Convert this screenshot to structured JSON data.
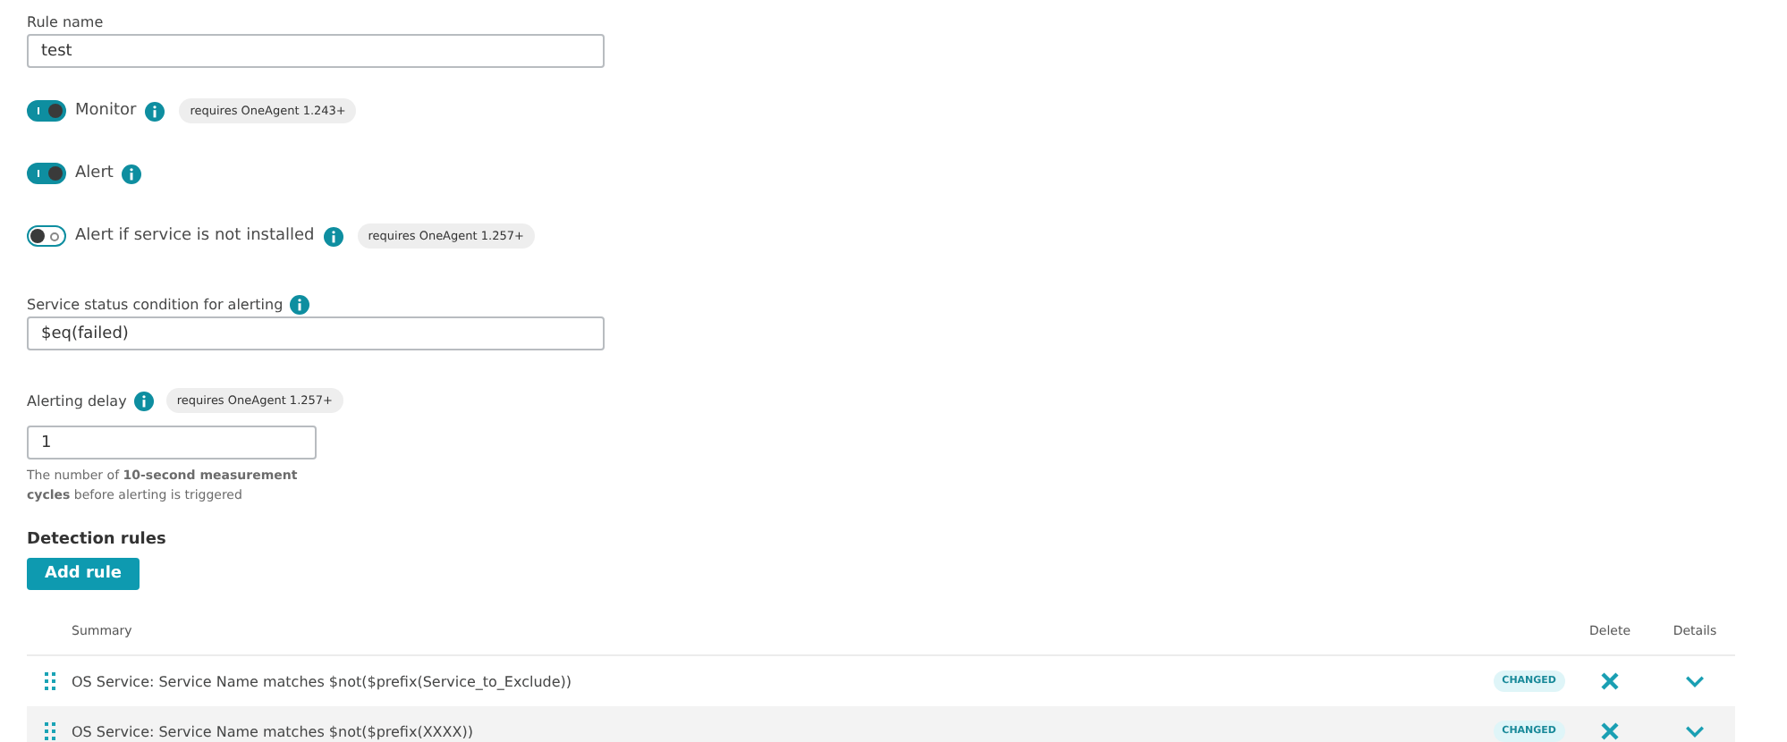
{
  "rule_name": {
    "label": "Rule name",
    "value": "test"
  },
  "toggles": [
    {
      "label": "Monitor",
      "on": true,
      "badge": "requires OneAgent 1.243+"
    },
    {
      "label": "Alert",
      "on": true
    },
    {
      "label": "Alert if service is not installed",
      "on": false,
      "badge": "requires OneAgent 1.257+"
    }
  ],
  "status_condition": {
    "label": "Service status condition for alerting",
    "value": "$eq(failed)"
  },
  "alerting_delay": {
    "label": "Alerting delay",
    "badge": "requires OneAgent 1.257+",
    "value": "1",
    "help": "The number of **10-second measurement cycles** before alerting is triggered"
  },
  "detection_rules": {
    "title": "Detection rules",
    "add_button": "Add rule",
    "columns": [
      "Summary",
      "Delete",
      "Details"
    ],
    "rows": [
      {
        "summary": "OS Service: Service Name matches $not($prefix(Service_to_Exclude))",
        "tag": "CHANGED"
      },
      {
        "summary": "OS Service: Service Name matches $not($prefix(XXXX))",
        "tag": "CHANGED"
      }
    ]
  }
}
